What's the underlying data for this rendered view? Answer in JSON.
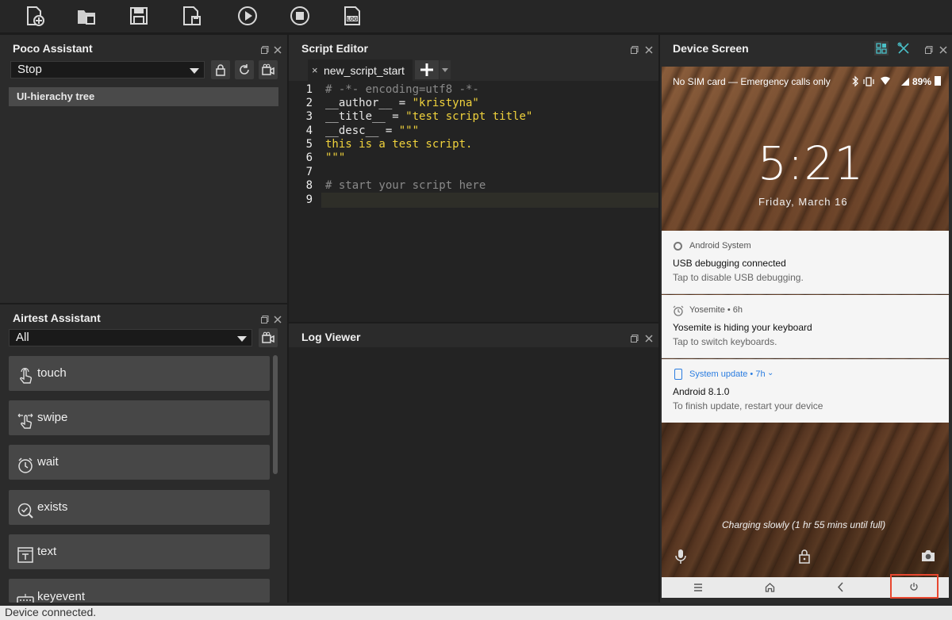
{
  "toolbar": {
    "buttons": [
      "new-script",
      "open-script",
      "save-script",
      "save-as",
      "run",
      "stop",
      "log"
    ]
  },
  "poco": {
    "title": "Poco Assistant",
    "mode_value": "Stop",
    "tree_item": "UI-hierachy tree"
  },
  "airtest": {
    "title": "Airtest Assistant",
    "filter_value": "All",
    "actions": [
      {
        "label": "touch",
        "icon": "touch-icon"
      },
      {
        "label": "swipe",
        "icon": "swipe-icon"
      },
      {
        "label": "wait",
        "icon": "clock-icon"
      },
      {
        "label": "exists",
        "icon": "check-circle-icon"
      },
      {
        "label": "text",
        "icon": "text-icon"
      },
      {
        "label": "keyevent",
        "icon": "keyboard-icon"
      }
    ]
  },
  "editor": {
    "title": "Script Editor",
    "tab_label": "new_script_start",
    "tab_close": "×",
    "lines": [
      {
        "n": "1",
        "text": "# -*- encoding=utf8 -*-",
        "kind": "comment"
      },
      {
        "n": "2",
        "text": "__author__ = \"kristyna\"",
        "kind": "assign"
      },
      {
        "n": "3",
        "text": "__title__ = \"test script title\"",
        "kind": "assign"
      },
      {
        "n": "4",
        "text": "__desc__ = \"\"\"",
        "kind": "assign"
      },
      {
        "n": "5",
        "text": "this is a test script.",
        "kind": "string"
      },
      {
        "n": "6",
        "text": "\"\"\"",
        "kind": "string"
      },
      {
        "n": "7",
        "text": "",
        "kind": "blank"
      },
      {
        "n": "8",
        "text": "# start your script here",
        "kind": "comment"
      },
      {
        "n": "9",
        "text": "",
        "kind": "blank"
      }
    ]
  },
  "log": {
    "title": "Log Viewer"
  },
  "device": {
    "title": "Device Screen",
    "status_left": "No SIM card — Emergency calls only",
    "battery": "89%",
    "time": "5:21",
    "date": "Friday, March 16",
    "notifications": [
      {
        "source": "Android System",
        "title": "USB debugging connected",
        "subtitle": "Tap to disable USB debugging."
      },
      {
        "source": "Yosemite • 6h",
        "title": "Yosemite is hiding your keyboard",
        "subtitle": "Tap to switch keyboards."
      },
      {
        "source": "System update • 7h",
        "title": "Android 8.1.0",
        "subtitle": "To finish update, restart your device"
      }
    ],
    "charging": "Charging slowly (1 hr 55 mins until full)"
  },
  "status": {
    "text": "Device connected."
  },
  "colors": {
    "accent_red": "#e8472f",
    "code_yellow": "#f0d23c",
    "code_comment": "#8a8a8a",
    "system_update_blue": "#2b7de0"
  }
}
